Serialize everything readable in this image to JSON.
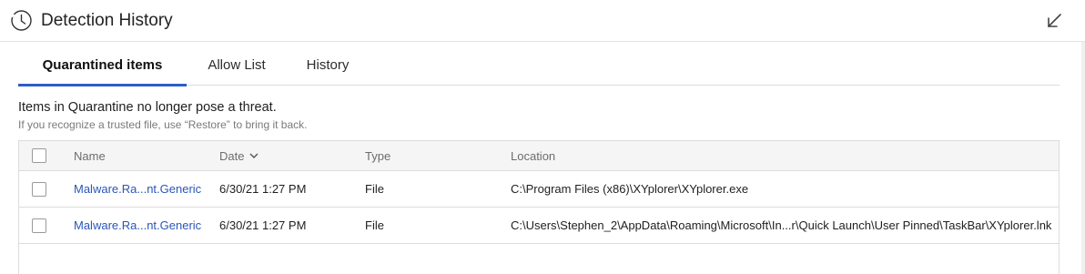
{
  "window": {
    "title": "Detection History",
    "title_icon": "history-clock-icon",
    "collapse_icon": "arrow-down-left-icon"
  },
  "tabs": [
    {
      "label": "Quarantined items",
      "active": true
    },
    {
      "label": "Allow List",
      "active": false
    },
    {
      "label": "History",
      "active": false
    }
  ],
  "info": {
    "main": "Items in Quarantine no longer pose a threat.",
    "sub": "If you recognize a trusted file, use “Restore” to bring it back."
  },
  "table": {
    "columns": {
      "name": "Name",
      "date": "Date",
      "type": "Type",
      "location": "Location"
    },
    "sort_icon": "chevron-down-icon",
    "rows": [
      {
        "name": "Malware.Ra...nt.Generic",
        "date": "6/30/21 1:27 PM",
        "type": "File",
        "location": "C:\\Program Files (x86)\\XYplorer\\XYplorer.exe"
      },
      {
        "name": "Malware.Ra...nt.Generic",
        "date": "6/30/21 1:27 PM",
        "type": "File",
        "location": "C:\\Users\\Stephen_2\\AppData\\Roaming\\Microsoft\\In...r\\Quick Launch\\User Pinned\\TaskBar\\XYplorer.lnk"
      }
    ]
  },
  "colors": {
    "accent": "#2f5dc4",
    "link": "#2a56b8",
    "muted": "#7a7a7a"
  }
}
